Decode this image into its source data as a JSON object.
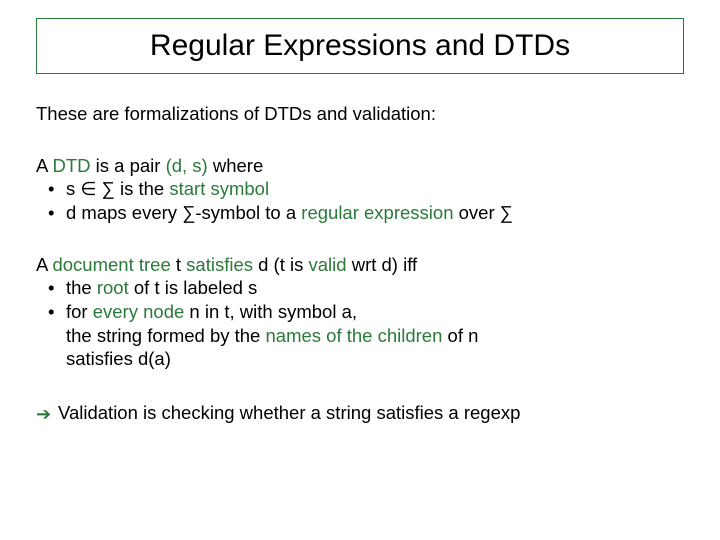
{
  "title": "Regular Expressions and DTDs",
  "intro": "These are formalizations of DTDs and validation:",
  "p2": {
    "line1_a": "A ",
    "line1_dtd": "DTD",
    "line1_b": " is a pair ",
    "line1_pair": "(d, s)",
    "line1_c": " where",
    "b1_a": "s ",
    "b1_in": "∈",
    "b1_b": " ",
    "b1_sigma": "∑",
    "b1_c": " is the ",
    "b1_start": "start symbol",
    "b2_a": "d maps every ",
    "b2_sigma": "∑",
    "b2_b": "-symbol to a ",
    "b2_re": "regular expression",
    "b2_c": " over ",
    "b2_sigma2": "∑"
  },
  "p3": {
    "l1_a": "A ",
    "l1_doc": "document tree",
    "l1_b": " t ",
    "l1_sat": "satisfies",
    "l1_c": " d (t is ",
    "l1_valid": "valid",
    "l1_d": " wrt d) iff",
    "b1_a": "the ",
    "b1_root": "root",
    "b1_b": " of t is labeled s",
    "b2_a": "for ",
    "b2_every": "every node",
    "b2_b": " n in t, with symbol a,",
    "b2_cont1_a": "the string formed by the ",
    "b2_cont1_names": "names of the children",
    "b2_cont1_b": " of n",
    "b2_cont2": "satisfies d(a)"
  },
  "conclusion": "Validation is checking whether a string satisfies a regexp"
}
